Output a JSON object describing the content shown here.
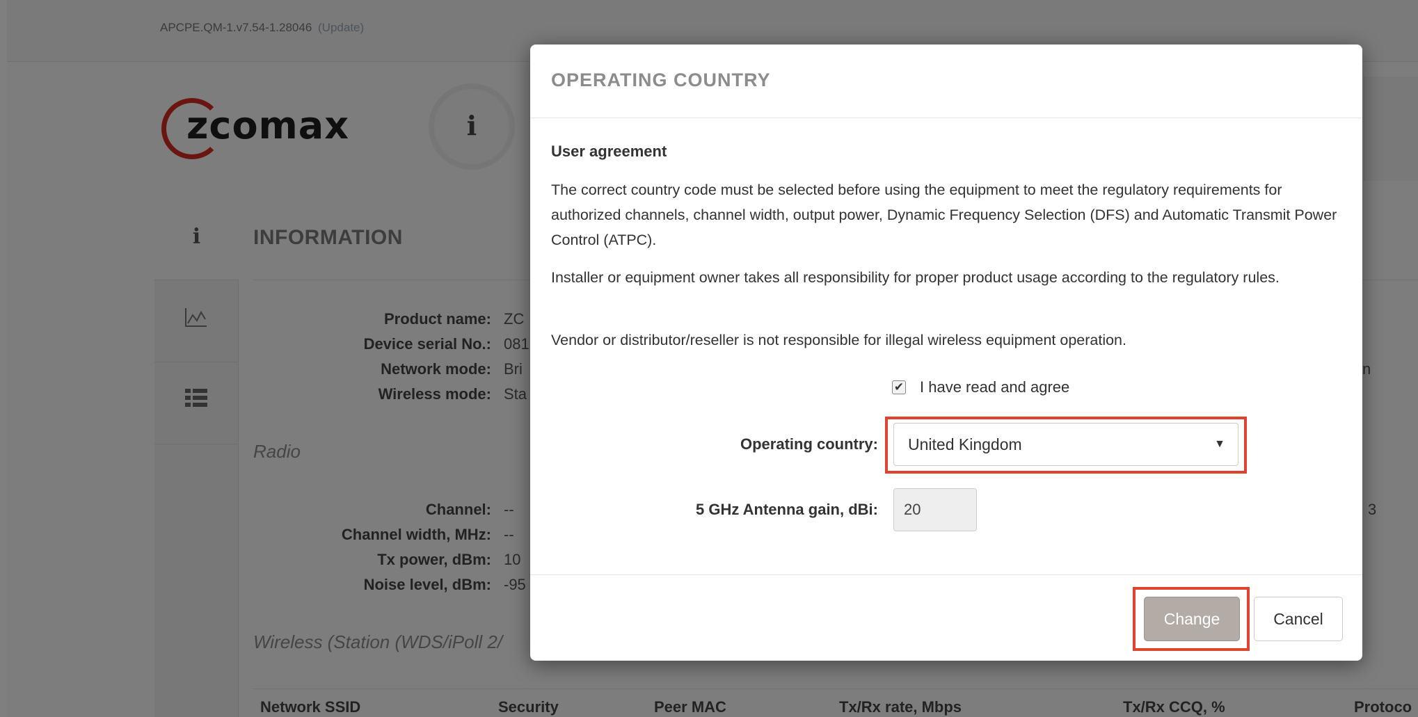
{
  "topbar": {
    "firmware": "APCPE.QM-1.v7.54-1.28046",
    "update_link": "(Update)"
  },
  "brand": {
    "logo_text": "zcomax"
  },
  "info_badge": "i",
  "tabs": [
    {
      "icon": "info-icon",
      "glyph": "i"
    },
    {
      "icon": "chart-icon",
      "glyph": "📈"
    },
    {
      "icon": "list-icon",
      "glyph": "☷"
    }
  ],
  "information": {
    "title": "INFORMATION",
    "device": [
      {
        "label": "Product name:",
        "value": "ZC"
      },
      {
        "label": "Device serial No.:",
        "value": "081"
      },
      {
        "label": "Network mode:",
        "value": "Bri"
      },
      {
        "label": "Wireless mode:",
        "value": "Sta"
      }
    ],
    "radio_title": "Radio",
    "radio": [
      {
        "label": "Channel:",
        "value": "--"
      },
      {
        "label": "Channel width, MHz:",
        "value": "--"
      },
      {
        "label": "Tx power, dBm:",
        "value": "10"
      },
      {
        "label": "Noise level, dBm:",
        "value": "-95"
      }
    ],
    "wireless_title": "Wireless (Station (WDS/iPoll 2/",
    "right_edge": [
      "n",
      "3"
    ],
    "table_headers": [
      "Network SSID",
      "Security",
      "Peer MAC",
      "Tx/Rx rate, Mbps",
      "Tx/Rx CCQ, %",
      "Protoco"
    ]
  },
  "modal": {
    "title": "OPERATING COUNTRY",
    "agreement_title": "User agreement",
    "para1": "The correct country code must be selected before using the equipment to meet the regulatory requirements for authorized channels, channel width, output power, Dynamic Frequency Selection (DFS) and Automatic Transmit Power Control (ATPC).",
    "para2": "Installer or equipment owner takes all responsibility for proper product usage according to the regulatory rules.",
    "para3": "Vendor or distributor/reseller is not responsible for illegal wireless equipment operation.",
    "agree_label": "I have read and agree",
    "agree_checked": true,
    "country_label": "Operating country:",
    "country_value": "United Kingdom",
    "gain_label": "5 GHz Antenna gain, dBi:",
    "gain_value": "20",
    "change_label": "Change",
    "cancel_label": "Cancel",
    "highlight_color": "#e0432f"
  }
}
